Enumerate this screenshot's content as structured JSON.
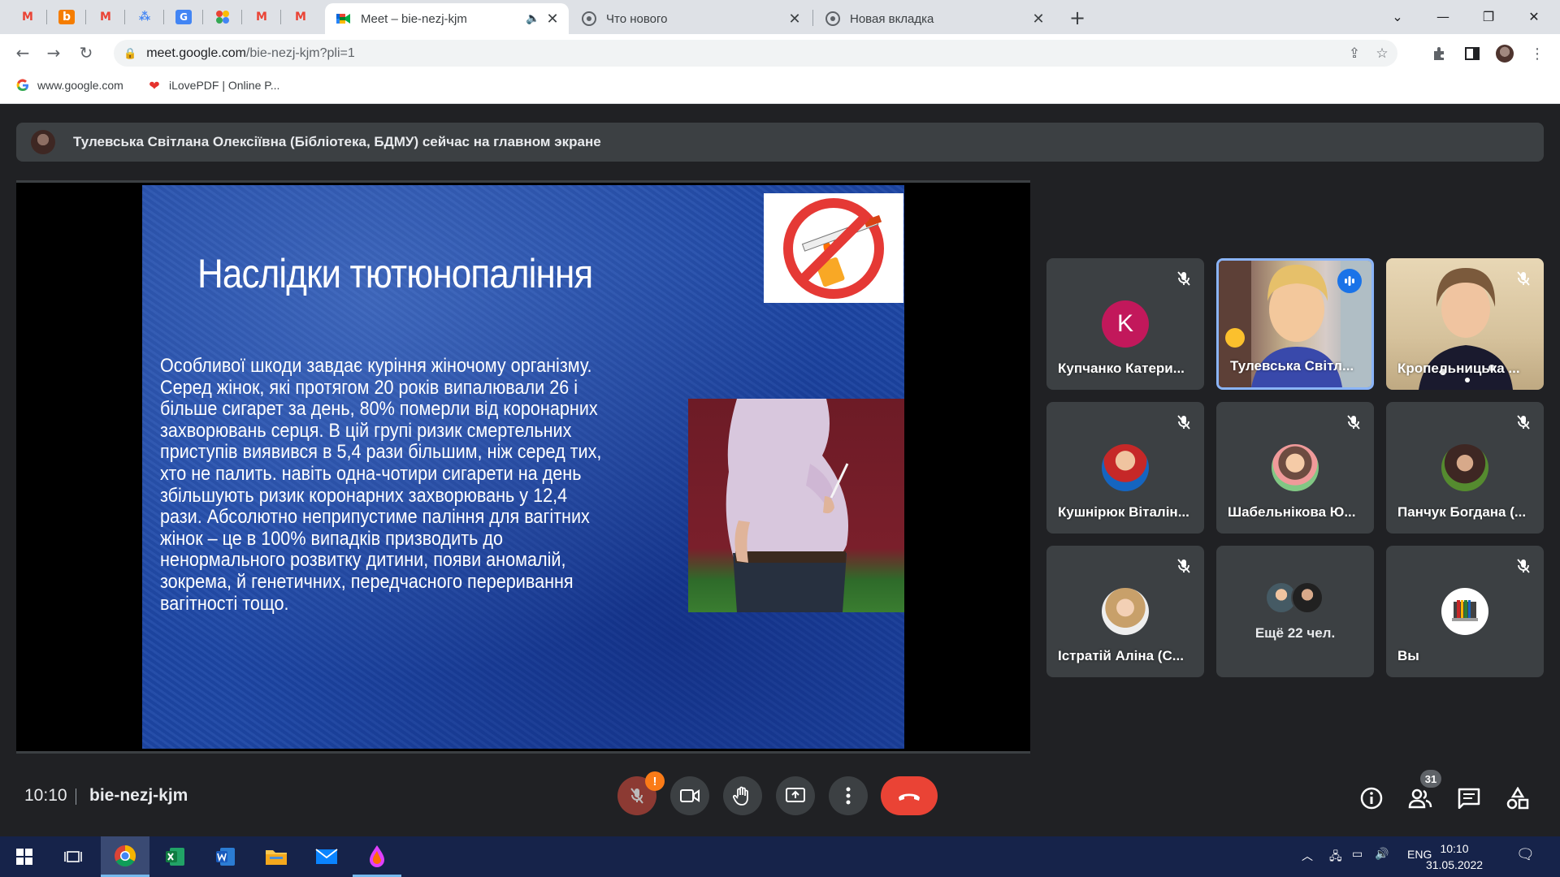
{
  "browser": {
    "pinned_tabs": [
      {
        "icon": "gmail-icon",
        "glyph": "M",
        "color": "#ea4335"
      },
      {
        "icon": "blogger-icon",
        "glyph": "b",
        "color": "#f57d00"
      },
      {
        "icon": "gmail-icon",
        "glyph": "M",
        "color": "#ea4335"
      },
      {
        "icon": "dashboard-icon",
        "glyph": "⁂",
        "color": "#4285f4"
      },
      {
        "icon": "translate-icon",
        "glyph": "G",
        "color": "#4285f4"
      },
      {
        "icon": "apps-icon",
        "glyph": "✿",
        "color": "#34a853"
      },
      {
        "icon": "gmail-icon",
        "glyph": "M",
        "color": "#ea4335"
      },
      {
        "icon": "gmail-icon",
        "glyph": "M",
        "color": "#ea4335"
      }
    ],
    "tabs": [
      {
        "title": "Meet – bie-nezj-kjm",
        "active": true
      },
      {
        "title": "Что нового",
        "active": false
      },
      {
        "title": "Новая вкладка",
        "active": false
      }
    ],
    "new_tab_label": "+",
    "url_host": "meet.google.com",
    "url_path": "/bie-nezj-kjm?pli=1",
    "bookmarks": [
      {
        "label": "www.google.com"
      },
      {
        "label": "iLovePDF | Online P..."
      }
    ]
  },
  "meet": {
    "banner_text": "Тулевська Світлана Олексіївна (Бібліотека, БДМУ) сейчас на главном экране",
    "slide": {
      "title": "Наслідки тютюнопаління",
      "body": "Особливої шкоди завдає куріння жіночому організму.\nСеред жінок, які протягом 20 років випалювали 26 і\nбільше сигарет за день, 80% померли від коронарних\nзахворювань серця. В цій групі ризик смертельних\nприступів виявився в 5,4 рази більшим, ніж серед тих,\nхто не палить. навіть одна-чотири сигарети на день\nзбільшують ризик коронарних захворювань у 12,4\nрази. Абсолютно неприпустиме паління для вагітних\nжінок – це в 100% випадків призводить до\nненормального розвитку дитини, появи аномалій,\nзокрема, й генетичних, передчасного переривання\nвагітності тощо."
    },
    "participants": [
      {
        "name": "Купчанко Катери...",
        "avatar_letter": "K",
        "avatar_color": "#c2185b",
        "muted": true,
        "kind": "letter"
      },
      {
        "name": "Тулевська Світл...",
        "muted": false,
        "kind": "video",
        "speaking": true
      },
      {
        "name": "Кропельницька ...",
        "muted": true,
        "kind": "video"
      },
      {
        "name": "Кушнірюк Віталін...",
        "muted": true,
        "kind": "photo"
      },
      {
        "name": "Шабельнікова Ю...",
        "muted": true,
        "kind": "photo"
      },
      {
        "name": "Панчук Богдана (...",
        "muted": true,
        "kind": "photo"
      },
      {
        "name": "Істратій Аліна (С...",
        "muted": true,
        "kind": "photo"
      },
      {
        "name": "Ещё 22 чел.",
        "kind": "more"
      },
      {
        "name": "Вы",
        "muted": true,
        "kind": "photo"
      }
    ],
    "time": "10:10",
    "meeting_code": "bie-nezj-kjm",
    "mic_warning": "!",
    "participant_count": "31"
  },
  "taskbar": {
    "language": "ENG",
    "time": "10:10",
    "date": "31.05.2022"
  },
  "colors": {
    "meet_bg": "#202124",
    "tile_bg": "#3c4043",
    "end_call": "#ea4335",
    "speaking_border": "#8ab4f8",
    "slide_blue": "#1d47a6"
  }
}
